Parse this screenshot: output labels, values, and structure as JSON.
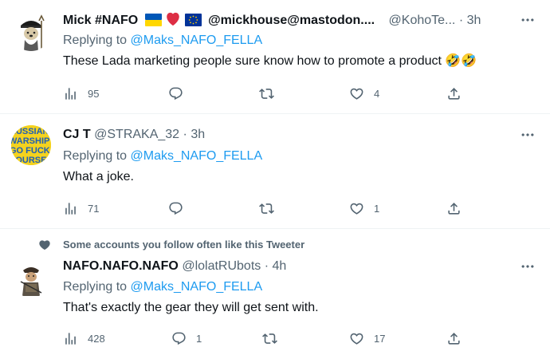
{
  "tweets": [
    {
      "name": "Mick #NAFO",
      "handle_display": "@mickhouse@mastodon....",
      "username": "@KohoTe...",
      "time": "3h",
      "reply_prefix": "Replying to",
      "reply_to": "@Maks_NAFO_FELLA",
      "text": "These Lada marketing people sure know how to promote a product 🤣🤣",
      "views": "95",
      "replies": "",
      "retweets": "",
      "likes": "4"
    },
    {
      "name": "CJ T",
      "username": "@STRAKA_32",
      "time": "3h",
      "reply_prefix": "Replying to",
      "reply_to": "@Maks_NAFO_FELLA",
      "text": "What a joke.",
      "avatar_text": "RUSSIAN WARSHIP GO FUCK YOURSELF",
      "views": "71",
      "replies": "",
      "retweets": "",
      "likes": "1"
    },
    {
      "social_context": "Some accounts you follow often like this Tweeter",
      "name": "NAFO.NAFO.NAFO",
      "username": "@lolatRUbots",
      "time": "4h",
      "reply_prefix": "Replying to",
      "reply_to": "@Maks_NAFO_FELLA",
      "text": "That's exactly the gear they will get sent with.",
      "views": "428",
      "replies": "1",
      "retweets": "",
      "likes": "17"
    }
  ],
  "icons": {
    "views": "analytics-icon",
    "reply": "reply-icon",
    "retweet": "retweet-icon",
    "like": "like-icon",
    "share": "share-icon",
    "more": "more-icon"
  },
  "colors": {
    "link": "#1d9bf0",
    "muted": "#536471",
    "text": "#0f1419",
    "separator": "#eff3f4"
  }
}
